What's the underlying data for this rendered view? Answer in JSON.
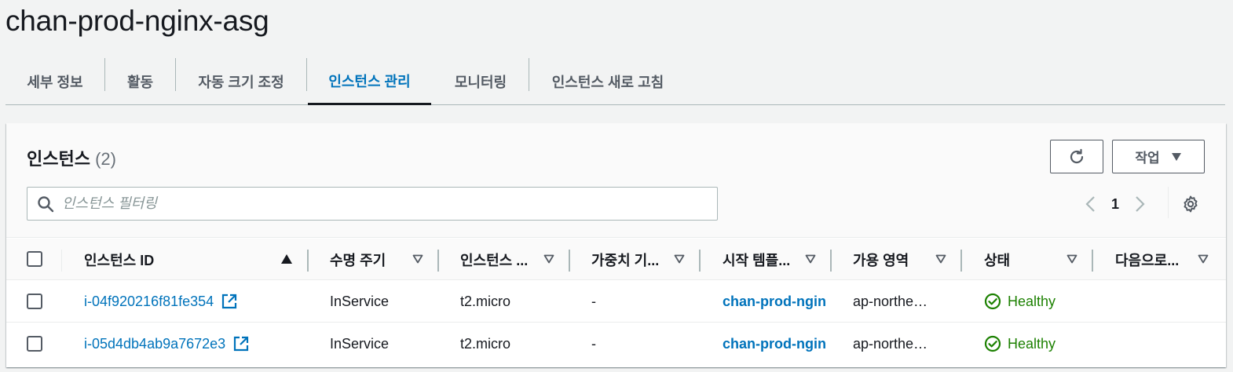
{
  "page": {
    "title": "chan-prod-nginx-asg"
  },
  "tabs": [
    {
      "label": "세부 정보"
    },
    {
      "label": "활동"
    },
    {
      "label": "자동 크기 조정"
    },
    {
      "label": "인스턴스 관리",
      "active": true
    },
    {
      "label": "모니터링"
    },
    {
      "label": "인스턴스 새로 고침"
    }
  ],
  "instances": {
    "title": "인스턴스",
    "count": "(2)",
    "actions_label": "작업",
    "search_placeholder": "인스턴스 필터링",
    "page_number": "1",
    "columns": [
      {
        "label": "인스턴스 ID"
      },
      {
        "label": "수명 주기"
      },
      {
        "label": "인스턴스 ..."
      },
      {
        "label": "가중치 기..."
      },
      {
        "label": "시작 템플..."
      },
      {
        "label": "가용 영역"
      },
      {
        "label": "상태"
      },
      {
        "label": "다음으로..."
      }
    ],
    "rows": [
      {
        "id": "i-04f920216f81fe354",
        "lifecycle": "InService",
        "type": "t2.micro",
        "weight": "-",
        "template": "chan-prod-ngin",
        "az": "ap-northe…",
        "health": "Healthy",
        "next": ""
      },
      {
        "id": "i-05d4db4ab9a7672e3",
        "lifecycle": "InService",
        "type": "t2.micro",
        "weight": "-",
        "template": "chan-prod-ngin",
        "az": "ap-northe…",
        "health": "Healthy",
        "next": ""
      }
    ]
  },
  "colors": {
    "link": "#0073bb",
    "healthy": "#1d8102",
    "text": "#16191f",
    "muted": "#545b64"
  },
  "icons": [
    "search-icon",
    "refresh-icon",
    "caret-down-icon",
    "chevron-left-icon",
    "chevron-right-icon",
    "gear-icon",
    "sort-ascending-icon",
    "sort-icon",
    "external-link-icon",
    "check-circle-icon"
  ]
}
